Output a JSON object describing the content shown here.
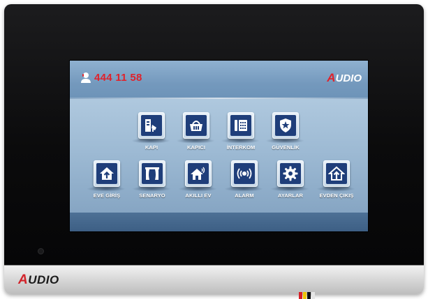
{
  "header": {
    "phone_number": "444 11 58",
    "logo_letter": "A",
    "logo_rest": "UDIO"
  },
  "bezel": {
    "logo_letter": "A",
    "logo_rest": "UDIO"
  },
  "menu": {
    "row1": [
      {
        "label": "KAPI",
        "icon": "door-camera-icon"
      },
      {
        "label": "KAPICI",
        "icon": "basket-icon"
      },
      {
        "label": "İNTERKOM",
        "icon": "intercom-phone-icon"
      },
      {
        "label": "GÜVENLİK",
        "icon": "shield-icon"
      }
    ],
    "row2": [
      {
        "label": "EVE GİRİŞ",
        "icon": "home-enter-icon"
      },
      {
        "label": "SENARYO",
        "icon": "curtain-icon"
      },
      {
        "label": "AKILLI EV",
        "icon": "smart-home-icon"
      },
      {
        "label": "ALARM",
        "icon": "alarm-signal-icon"
      },
      {
        "label": "AYARLAR",
        "icon": "gear-icon"
      },
      {
        "label": "EVDEN ÇIKIŞ",
        "icon": "home-exit-icon"
      }
    ]
  },
  "colors": {
    "accent_red": "#e0222b",
    "icon_blue": "#1f3e7a",
    "screen_bg": "#9cb9d3"
  }
}
